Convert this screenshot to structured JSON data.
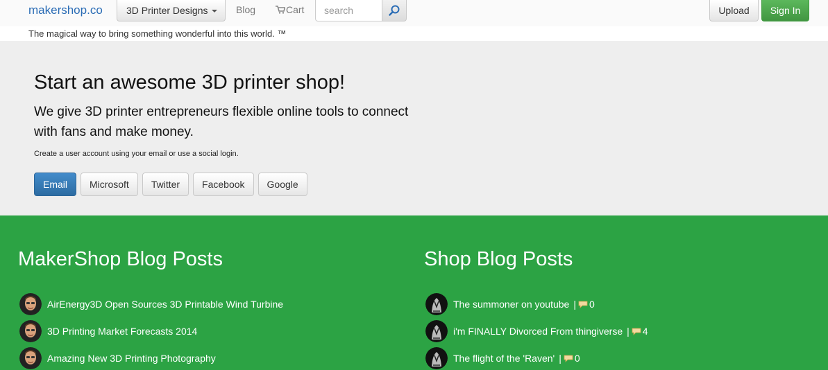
{
  "navbar": {
    "brand": "makershop.co",
    "designs_label": "3D Printer Designs",
    "blog_label": "Blog",
    "cart_label": "Cart",
    "search_placeholder": "search",
    "upload_label": "Upload",
    "signin_label": "Sign In"
  },
  "tagline": "The magical way to bring something wonderful into this world. ™",
  "hero": {
    "title": "Start an awesome 3D printer shop!",
    "subtitle": "We give 3D printer entrepreneurs flexible online tools to connect with fans and make money.",
    "note": "Create a user account using your email or use a social login.",
    "buttons": [
      "Email",
      "Microsoft",
      "Twitter",
      "Facebook",
      "Google"
    ]
  },
  "makershop_blog": {
    "heading": "MakerShop Blog Posts",
    "posts": [
      "AirEnergy3D Open Sources 3D Printable Wind Turbine",
      "3D Printing Market Forecasts 2014",
      "Amazing New 3D Printing Photography"
    ]
  },
  "shop_blog": {
    "heading": "Shop Blog Posts",
    "posts": [
      {
        "title": "The summoner on youtube",
        "comments": "0"
      },
      {
        "title": "i'm FINALLY Divorced From thingiverse",
        "comments": "4"
      },
      {
        "title": "The flight of the 'Raven'",
        "comments": "0"
      }
    ]
  },
  "colors": {
    "brand_blue": "#2a6cb5",
    "signin_green": "#4cae4c",
    "blog_green": "#2ca344",
    "hero_gray": "#eeeeee",
    "email_blue": "#357ebd"
  },
  "icons": [
    "caret-down-icon",
    "cart-icon",
    "search-icon",
    "comment-bubble-icon"
  ]
}
